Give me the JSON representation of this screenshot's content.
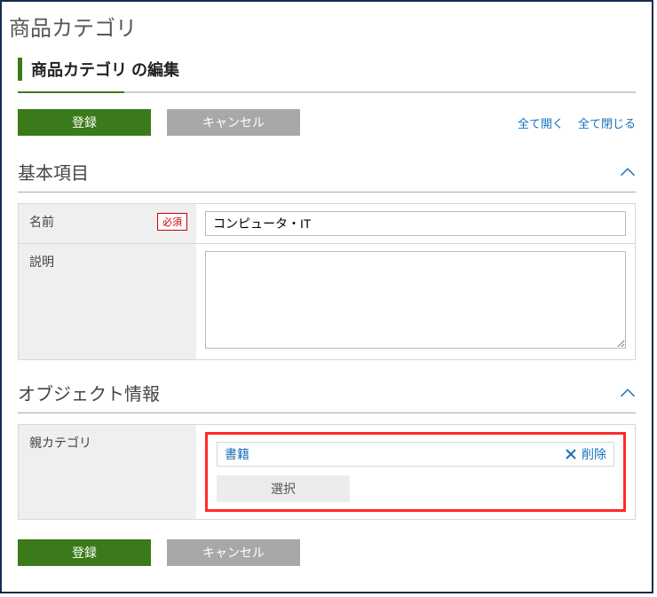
{
  "page": {
    "title": "商品カテゴリ",
    "subtitle": "商品カテゴリ の編集"
  },
  "actions": {
    "register": "登録",
    "cancel": "キャンセル",
    "open_all": "全て開く",
    "close_all": "全て閉じる"
  },
  "sections": {
    "basic": {
      "title": "基本項目",
      "fields": {
        "name": {
          "label": "名前",
          "required": "必須",
          "value": "コンピュータ・IT"
        },
        "description": {
          "label": "説明",
          "value": ""
        }
      }
    },
    "object": {
      "title": "オブジェクト情報",
      "fields": {
        "parent": {
          "label": "親カテゴリ",
          "selected": "書籍",
          "remove": "削除",
          "select_btn": "選択"
        }
      }
    }
  },
  "footer_actions": {
    "register": "登録",
    "cancel": "キャンセル"
  }
}
